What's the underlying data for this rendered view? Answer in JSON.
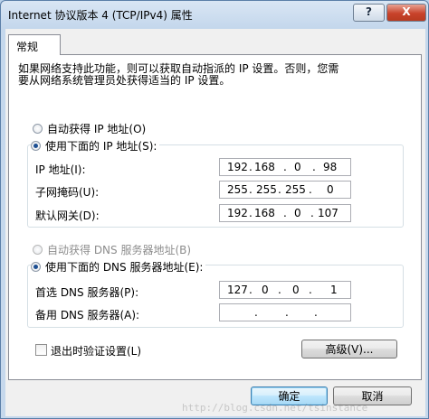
{
  "window": {
    "title": "Internet 协议版本 4 (TCP/IPv4) 属性",
    "help_label": "?",
    "close_label": "X"
  },
  "tab": {
    "label": "常规"
  },
  "description": "如果网络支持此功能，则可以获取自动指派的 IP 设置。否则，您需\n要从网络系统管理员处获得适当的 IP 设置。",
  "ip_section": {
    "auto_label": "自动获得 IP 地址(O)",
    "manual_label": "使用下面的 IP 地址(S):",
    "selected": "manual",
    "fields": [
      {
        "label": "IP 地址(I):",
        "octets": [
          "192",
          "168",
          "0",
          "98"
        ]
      },
      {
        "label": "子网掩码(U):",
        "octets": [
          "255",
          "255",
          "255",
          "0"
        ]
      },
      {
        "label": "默认网关(D):",
        "octets": [
          "192",
          "168",
          "0",
          "107"
        ]
      }
    ]
  },
  "dns_section": {
    "auto_label": "自动获得 DNS 服务器地址(B)",
    "manual_label": "使用下面的 DNS 服务器地址(E):",
    "selected": "manual",
    "fields": [
      {
        "label": "首选 DNS 服务器(P):",
        "octets": [
          "127",
          "0",
          "0",
          "1"
        ]
      },
      {
        "label": "备用 DNS 服务器(A):",
        "octets": [
          "",
          "",
          "",
          ""
        ]
      }
    ]
  },
  "validate_on_exit": {
    "label": "退出时验证设置(L)",
    "checked": false
  },
  "buttons": {
    "advanced": "高级(V)...",
    "ok": "确定",
    "cancel": "取消"
  },
  "watermark": "http://blog.csdn.net/tsinstance"
}
